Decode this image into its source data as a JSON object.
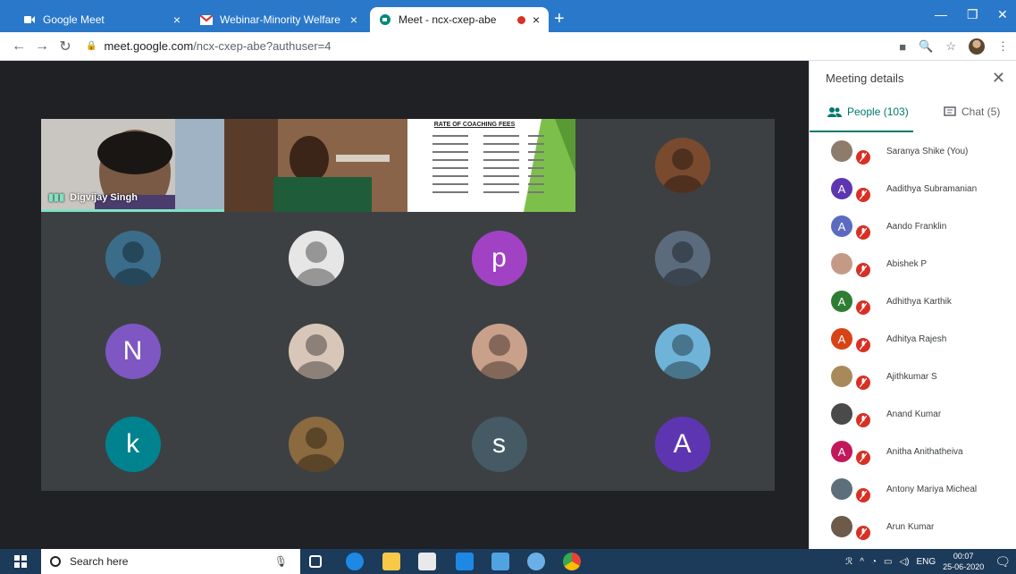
{
  "browser": {
    "tabs": [
      {
        "title": "Google Meet",
        "active": false
      },
      {
        "title": "Webinar-Minority Welfare Schem",
        "active": false
      },
      {
        "title": "Meet - ncx-cxep-abe",
        "active": true
      }
    ],
    "url_host": "meet.google.com",
    "url_path": "/ncx-cxep-abe?authuser=4"
  },
  "stage": {
    "speaker_name": "Digvijay Singh",
    "slide_title": "RATE OF COACHING FEES",
    "tiles": [
      {
        "kind": "video-woman-1"
      },
      {
        "kind": "video-woman-2"
      },
      {
        "kind": "presentation"
      },
      {
        "kind": "photo",
        "color": "#7a4a2f"
      },
      {
        "kind": "photo",
        "color": "#3b6d8a"
      },
      {
        "kind": "photo",
        "color": "#e6e6e6"
      },
      {
        "kind": "letter",
        "letter": "p",
        "color": "#a142c5"
      },
      {
        "kind": "photo",
        "color": "#5b6b7d"
      },
      {
        "kind": "letter",
        "letter": "N",
        "color": "#7e57c2"
      },
      {
        "kind": "photo",
        "color": "#d8c7b8"
      },
      {
        "kind": "photo",
        "color": "#c9a08a"
      },
      {
        "kind": "photo",
        "color": "#6fb4d8"
      },
      {
        "kind": "letter",
        "letter": "k",
        "color": "#00838f"
      },
      {
        "kind": "photo",
        "color": "#8a6a3e"
      },
      {
        "kind": "letter",
        "letter": "s",
        "color": "#455a64"
      },
      {
        "kind": "letter",
        "letter": "A",
        "color": "#5e35b1"
      }
    ]
  },
  "panel": {
    "title": "Meeting details",
    "people_tab": "People (103)",
    "chat_tab": "Chat (5)",
    "participants": [
      {
        "name": "Saranya Shike (You)",
        "letter": "",
        "color": "#8d7b6b"
      },
      {
        "name": "Aadithya Subramanian",
        "letter": "A",
        "color": "#5e35b1"
      },
      {
        "name": "Aando Franklin",
        "letter": "A",
        "color": "#5c6bc0"
      },
      {
        "name": "Abishek P",
        "letter": "",
        "color": "#c49a86"
      },
      {
        "name": "Adhithya Karthik",
        "letter": "A",
        "color": "#2e7d32"
      },
      {
        "name": "Adhitya Rajesh",
        "letter": "A",
        "color": "#d84315"
      },
      {
        "name": "Ajithkumar S",
        "letter": "",
        "color": "#a88a5a"
      },
      {
        "name": "Anand Kumar",
        "letter": "",
        "color": "#4a4a4a"
      },
      {
        "name": "Anitha Anithatheiva",
        "letter": "A",
        "color": "#c2185b"
      },
      {
        "name": "Antony Mariya Micheal",
        "letter": "",
        "color": "#5d6f7a"
      },
      {
        "name": "Arun Kumar",
        "letter": "",
        "color": "#6d5a4a"
      }
    ]
  },
  "taskbar": {
    "search_placeholder": "Search here",
    "lang": "ENG",
    "time": "00:07",
    "date": "25-06-2020"
  }
}
